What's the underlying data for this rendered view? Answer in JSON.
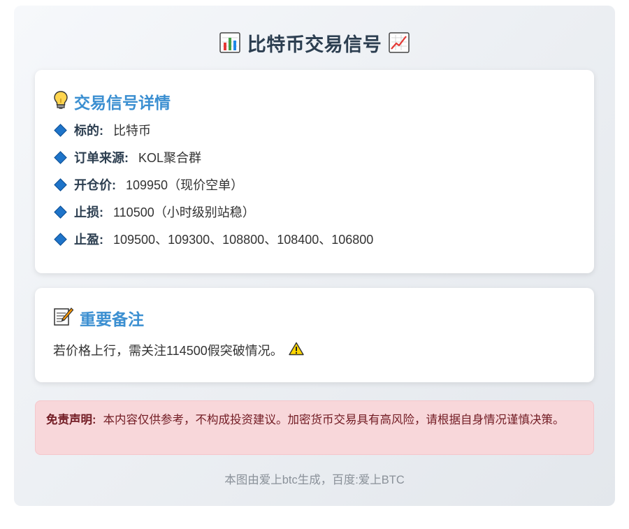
{
  "header": {
    "title": "比特币交易信号",
    "left_icon": "bar-chart-icon",
    "right_icon": "chart-increasing-icon"
  },
  "details": {
    "title": "交易信号详情",
    "icon": "light-bulb-icon",
    "items": [
      {
        "label": "标的:",
        "value": "比特币"
      },
      {
        "label": "订单来源:",
        "value": "KOL聚合群"
      },
      {
        "label": "开仓价:",
        "value": "109950（现价空单）"
      },
      {
        "label": "止损:",
        "value": "110500（小时级别站稳）"
      },
      {
        "label": "止盈:",
        "value": "109500、109300、108800、108400、106800"
      }
    ]
  },
  "notes": {
    "title": "重要备注",
    "icon": "memo-icon",
    "text": "若价格上行，需关注114500假突破情况。",
    "warning_icon": "warning-icon"
  },
  "disclaimer": {
    "label": "免责声明:",
    "text": "本内容仅供参考，不构成投资建议。加密货币交易具有高风险，请根据自身情况谨慎决策。"
  },
  "footer": {
    "text": "本图由爱上btc生成，百度:爱上BTC"
  },
  "colors": {
    "title": "#2c3e50",
    "section_title": "#3b8fd1",
    "diamond": "#1e74c9",
    "disclaimer_bg": "#f8d7da",
    "disclaimer_text": "#721c24",
    "footer": "#8a9199"
  }
}
